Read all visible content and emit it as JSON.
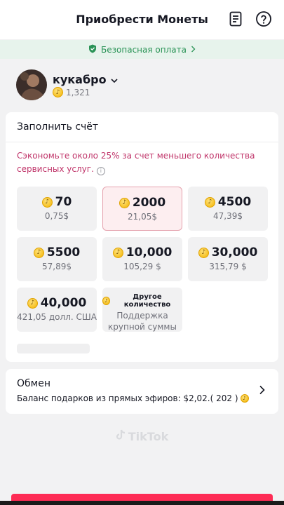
{
  "header": {
    "title": "Приобрести Монеты",
    "icons": [
      "document-icon",
      "help-icon"
    ]
  },
  "secure_banner": {
    "label": "Безопасная оплата"
  },
  "user": {
    "name": "кукабро",
    "balance": "1,321"
  },
  "recharge": {
    "title": "Заполнить счёт",
    "savings_note": "Сэкономьте около 25% за счет меньшего количества сервисных услуг.",
    "packages": [
      {
        "coins": "70",
        "price": "0,75$",
        "selected": false
      },
      {
        "coins": "2000",
        "price": "21,05$",
        "selected": true
      },
      {
        "coins": "4500",
        "price": "47,39$",
        "selected": false
      },
      {
        "coins": "5500",
        "price": "57,89$",
        "selected": false
      },
      {
        "coins": "10,000",
        "price": "105,29 $",
        "selected": false
      },
      {
        "coins": "30,000",
        "price": "315,79 $",
        "selected": false
      },
      {
        "coins": "40,000",
        "price": "421,05 долл. США",
        "selected": false
      }
    ],
    "other_amount": {
      "label": "Другое количество",
      "desc": "Поддержка крупной суммы"
    }
  },
  "exchange": {
    "title": "Обмен",
    "subtitle": "Баланс подарков из прямых эфиров: $2,02.( 202 )"
  },
  "watermark": "TikTok",
  "colors": {
    "accent": "#fe2c55",
    "secure_green": "#2a9356",
    "savings_pink": "#c0356a",
    "coin_gold": "#f2b300"
  }
}
